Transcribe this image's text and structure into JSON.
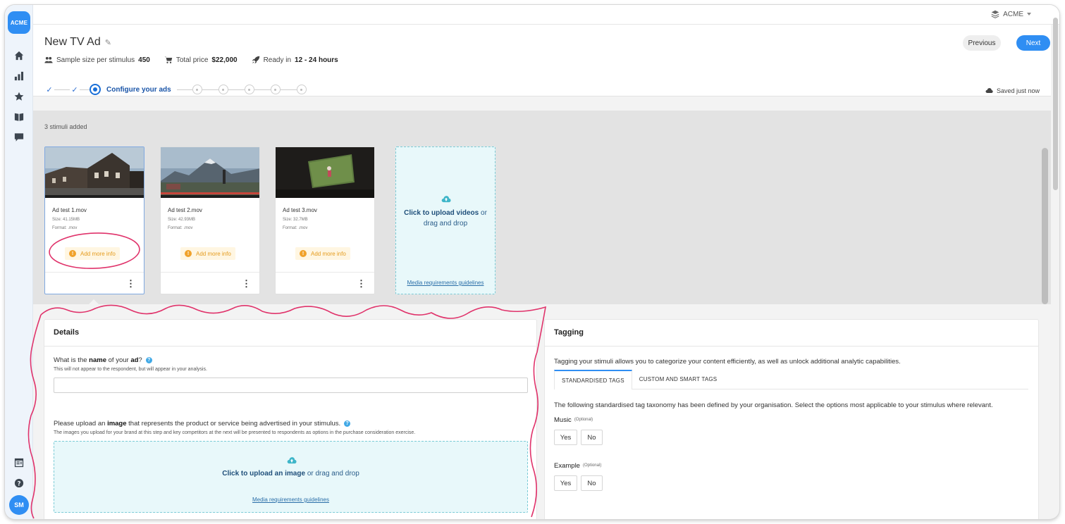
{
  "brand": {
    "logo_text": "ACME",
    "accent": "#2f8ef3"
  },
  "sidebar": {
    "items": [
      {
        "icon": "home-icon"
      },
      {
        "icon": "bar-chart-icon"
      },
      {
        "icon": "star-icon"
      },
      {
        "icon": "book-icon"
      },
      {
        "icon": "comment-icon"
      }
    ],
    "bottom": [
      {
        "icon": "table-icon"
      },
      {
        "icon": "help-icon"
      }
    ],
    "avatar_initials": "SM"
  },
  "topbar": {
    "org_name": "ACME"
  },
  "header": {
    "title": "New TV Ad",
    "meta": {
      "sample_label": "Sample size per stimulus",
      "sample_value": "450",
      "price_label": "Total price",
      "price_value": "$22,000",
      "ready_label": "Ready in",
      "ready_value": "12 - 24 hours"
    },
    "previous_label": "Previous",
    "next_label": "Next",
    "current_step_label": "Configure your ads",
    "saved_status": "Saved just now"
  },
  "stimuli": {
    "count_text": "3 stimuli added",
    "cards": [
      {
        "name": "Ad test 1.mov",
        "size": "Size: 41.15MB",
        "format": "Format: .mov",
        "warning": "Add more info"
      },
      {
        "name": "Ad test 2.mov",
        "size": "Size: 42.93MB",
        "format": "Format: .mov",
        "warning": "Add more info"
      },
      {
        "name": "Ad test 3.mov",
        "size": "Size: 32.7MB",
        "format": "Format: .mov",
        "warning": "Add more info"
      }
    ],
    "upload": {
      "bold": "Click to upload videos",
      "rest": " or drag and drop",
      "link": "Media requirements guidelines"
    }
  },
  "details": {
    "title": "Details",
    "name_q_pre": "What is the ",
    "name_q_bold1": "name",
    "name_q_mid": " of your ",
    "name_q_bold2": "ad",
    "name_q_end": "?",
    "name_sub": "This will not appear to the respondent, but will appear in your analysis.",
    "image_q_pre": "Please upload an ",
    "image_q_bold": "image",
    "image_q_end": " that represents the product or service being advertised in your stimulus.",
    "image_sub": "The images you upload for your brand at this step and key competitors at the next will be presented to respondents as options in the purchase consideration exercise.",
    "upload_bold": "Click to upload an image",
    "upload_rest": " or drag and drop",
    "upload_link": "Media requirements guidelines"
  },
  "tagging": {
    "title": "Tagging",
    "description": "Tagging your stimuli allows you to categorize your content efficiently, as well as unlock additional analytic capabilities.",
    "tabs": [
      "STANDARDISED TAGS",
      "CUSTOM AND SMART TAGS"
    ],
    "taxonomy_text": "The following standardised tag taxonomy has been defined by your organisation. Select the options most applicable to your stimulus where relevant.",
    "questions": [
      {
        "label": "Music",
        "optional": "(Optional)",
        "yes": "Yes",
        "no": "No"
      },
      {
        "label": "Example",
        "optional": "(Optional)",
        "yes": "Yes",
        "no": "No"
      }
    ]
  }
}
